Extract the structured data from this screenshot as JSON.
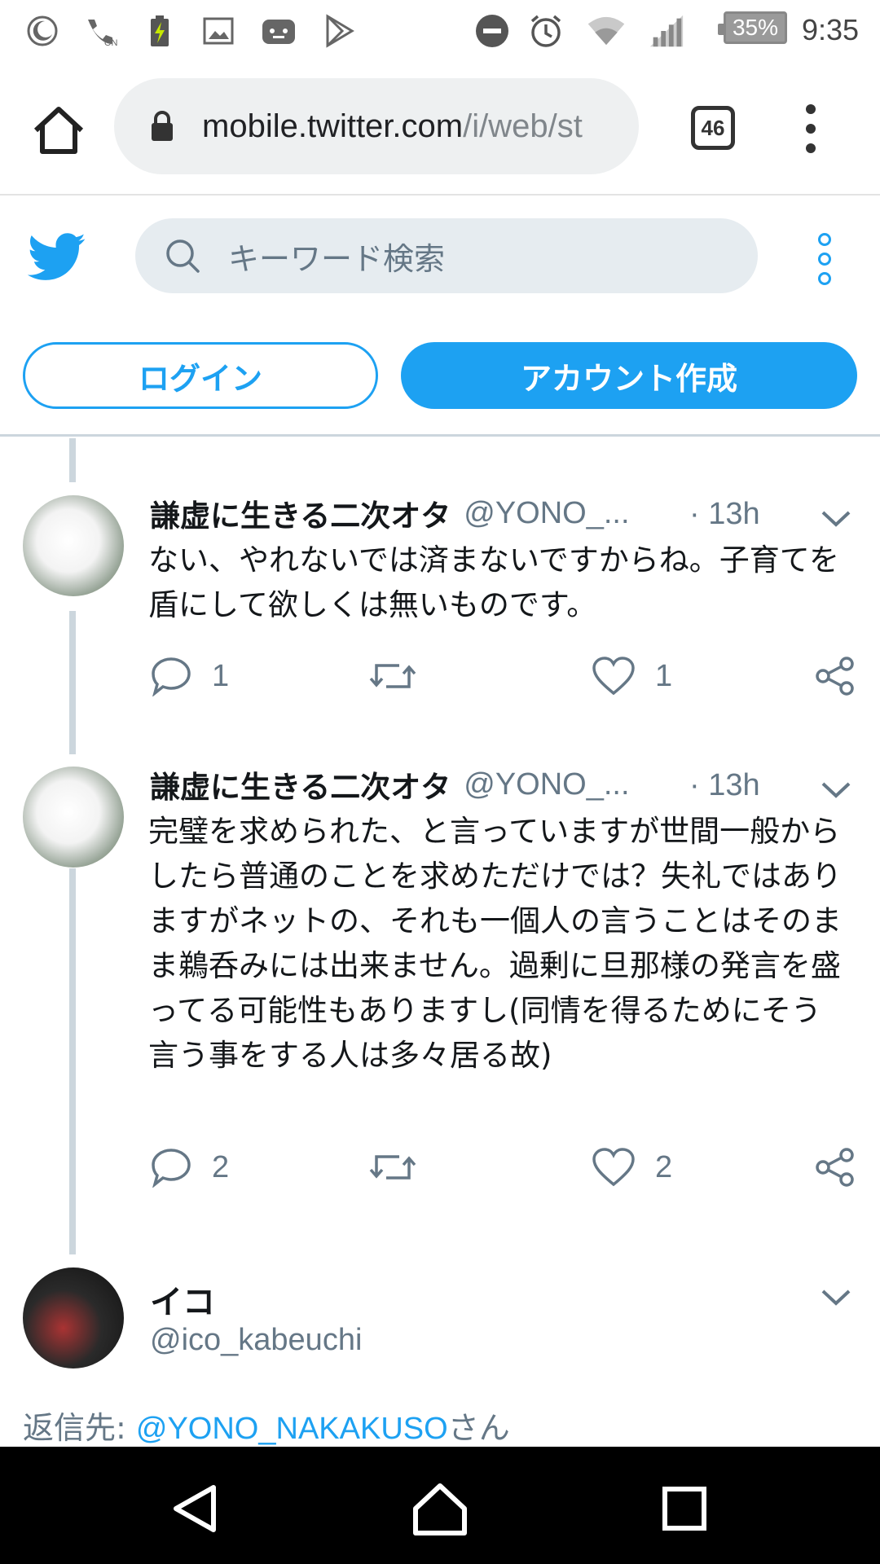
{
  "status_bar": {
    "battery": "35%",
    "time": "9:35",
    "icons_left": [
      "moon-icon",
      "wifi-call-icon",
      "battery-saver-icon",
      "image-icon",
      "app-icon",
      "play-store-icon"
    ],
    "icons_right": [
      "dnd-icon",
      "alarm-icon",
      "wifi-icon",
      "signal-icon"
    ]
  },
  "browser": {
    "url_host": "mobile.twitter.com",
    "url_path": "/i/web/st",
    "tab_count": "46"
  },
  "twitter": {
    "search_placeholder": "キーワード検索",
    "login_label": "ログイン",
    "signup_label": "アカウント作成",
    "brand_color": "#1da1f2"
  },
  "tweets": [
    {
      "name": "謙虚に生きる二次オタ",
      "handle": "@YONO_...",
      "time": "· 13h",
      "text": "ない、やれないでは済まないですからね。子育てを盾にして欲しくは無いものです。",
      "replies": "1",
      "likes": "1"
    },
    {
      "name": "謙虚に生きる二次オタ",
      "handle": "@YONO_...",
      "time": "· 13h",
      "text": "完璧を求められた、と言っていますが世間一般からしたら普通のことを求めただけでは？失礼ではありますがネットの、それも一個人の言うことはそのまま鵜呑みには出来ません。過剰に旦那様の発言を盛ってる可能性もありますし(同情を得るためにそう言う事をする人は多々居る故)",
      "replies": "2",
      "likes": "2"
    }
  ],
  "focused_tweet": {
    "name": "イコ",
    "handle": "@ico_kabeuchi",
    "reply_prefix": "返信先: ",
    "reply_target": "@YONO_NAKAKUSO",
    "reply_suffix": "さん"
  }
}
